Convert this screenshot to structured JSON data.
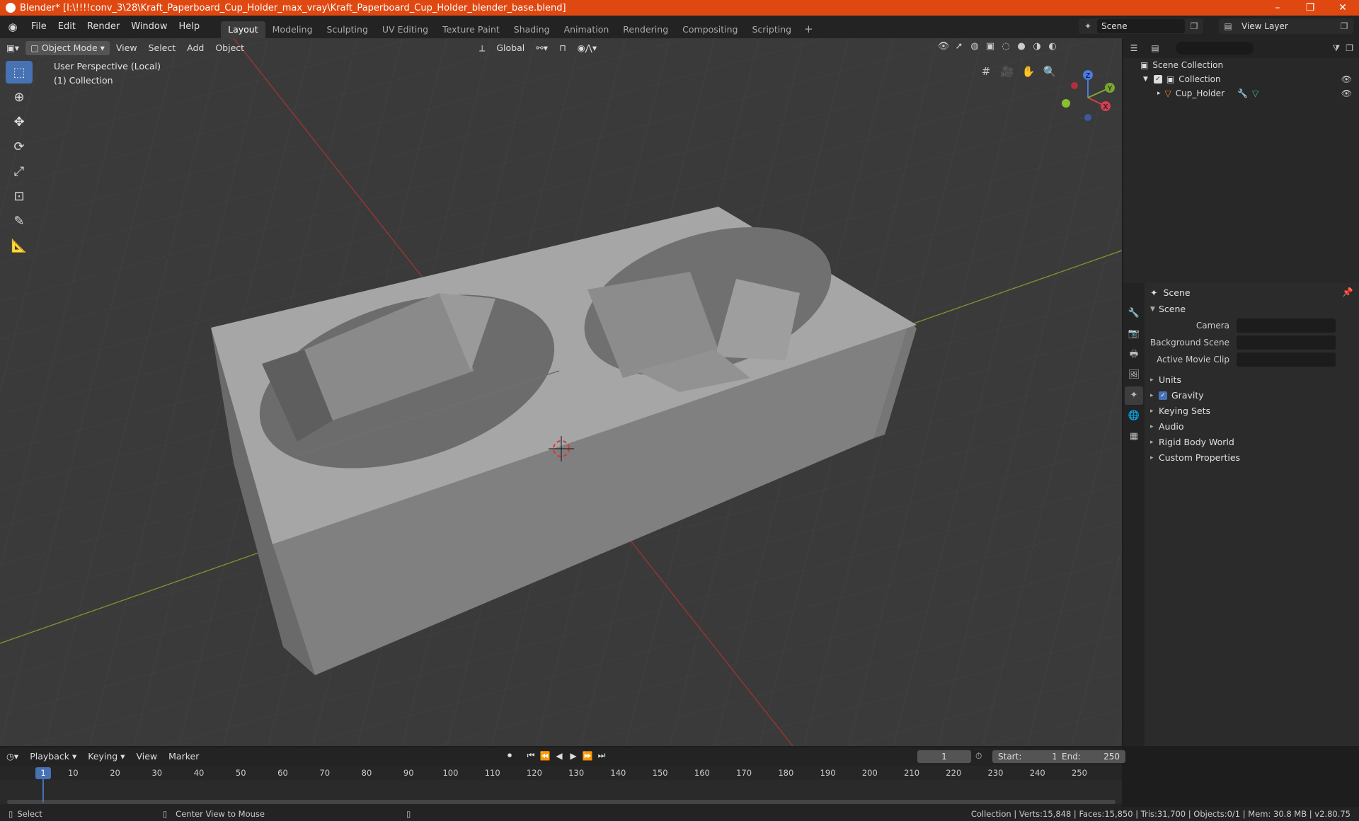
{
  "window": {
    "title": "Blender* [I:\\!!!!conv_3\\28\\Kraft_Paperboard_Cup_Holder_max_vray\\Kraft_Paperboard_Cup_Holder_blender_base.blend]",
    "minimize": "–",
    "maximize": "❐",
    "close": "✕"
  },
  "menu": [
    "File",
    "Edit",
    "Render",
    "Window",
    "Help"
  ],
  "workspaces": [
    "Layout",
    "Modeling",
    "Sculpting",
    "UV Editing",
    "Texture Paint",
    "Shading",
    "Animation",
    "Rendering",
    "Compositing",
    "Scripting"
  ],
  "workspace_add": "+",
  "scene_name": "Scene",
  "view_layer": "View Layer",
  "viewport": {
    "mode": "Object Mode",
    "menus": [
      "View",
      "Select",
      "Add",
      "Object"
    ],
    "orientation": "Global",
    "perspective_label": "User Perspective (Local)",
    "collection_label": "(1) Collection"
  },
  "gizmo": {
    "x": "X",
    "y": "Y",
    "z": "Z"
  },
  "outliner": {
    "search_placeholder": "",
    "items": [
      {
        "label": "Scene Collection"
      },
      {
        "label": "Collection"
      },
      {
        "label": "Cup_Holder"
      }
    ]
  },
  "properties": {
    "context": "Scene",
    "panel_scene": "Scene",
    "fields": [
      {
        "label": "Camera",
        "value": ""
      },
      {
        "label": "Background Scene",
        "value": ""
      },
      {
        "label": "Active Movie Clip",
        "value": ""
      }
    ],
    "panels": [
      "Units",
      "Gravity",
      "Keying Sets",
      "Audio",
      "Rigid Body World",
      "Custom Properties"
    ]
  },
  "timeline": {
    "menus": [
      "Playback",
      "Keying",
      "View",
      "Marker"
    ],
    "current_frame": "1",
    "start_label": "Start:",
    "start": "1",
    "end_label": "End:",
    "end": "250",
    "ticks": [
      "10",
      "20",
      "30",
      "40",
      "50",
      "60",
      "70",
      "80",
      "90",
      "100",
      "110",
      "120",
      "130",
      "140",
      "150",
      "160",
      "170",
      "180",
      "190",
      "200",
      "210",
      "220",
      "230",
      "240",
      "250"
    ],
    "playhead": "1"
  },
  "status": {
    "select": "Select",
    "center": "Center View to Mouse",
    "stats": "Collection | Verts:15,848 | Faces:15,850 | Tris:31,700 | Objects:0/1 | Mem: 30.8 MB | v2.80.75"
  }
}
